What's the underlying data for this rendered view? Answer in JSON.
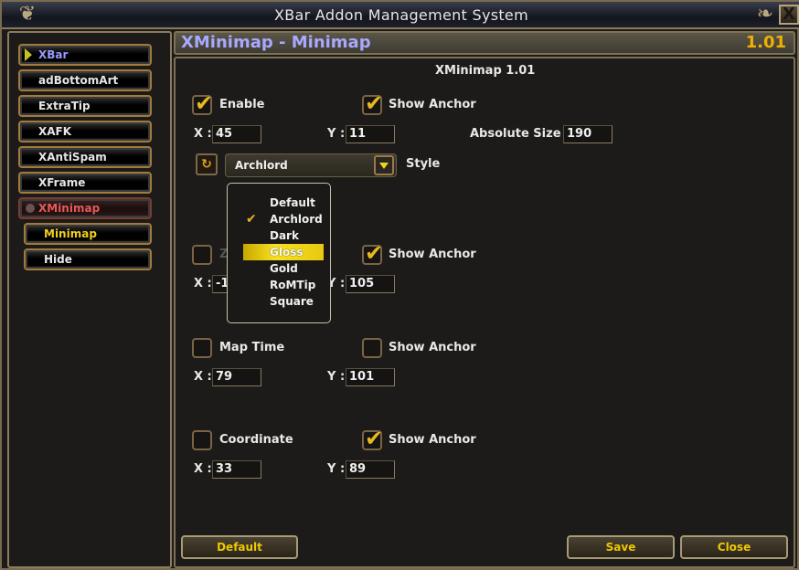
{
  "window": {
    "title": "XBar Addon Management System",
    "close_label": "X"
  },
  "sidebar": {
    "items": [
      {
        "label": "XBar",
        "state": "active"
      },
      {
        "label": "adBottomArt",
        "state": "normal"
      },
      {
        "label": "ExtraTip",
        "state": "normal"
      },
      {
        "label": "XAFK",
        "state": "normal"
      },
      {
        "label": "XAntiSpam",
        "state": "normal"
      },
      {
        "label": "XFrame",
        "state": "normal"
      },
      {
        "label": "XMinimap",
        "state": "expanded"
      }
    ],
    "subitems": [
      {
        "label": "Minimap",
        "state": "selected"
      },
      {
        "label": "Hide",
        "state": "normal"
      }
    ]
  },
  "panel": {
    "title": "XMinimap - Minimap",
    "version": "1.01",
    "heading": "XMinimap 1.01"
  },
  "minimap": {
    "enable": {
      "label": "Enable",
      "checked": true
    },
    "show_anchor": {
      "label": "Show Anchor",
      "checked": true
    },
    "x_label": "X :",
    "x": "45",
    "y_label": "Y :",
    "y": "11",
    "abs_size_label": "Absolute Size :",
    "abs_size": "190",
    "style_label": "Style",
    "style_value": "Archlord",
    "style_icon": "reset-icon"
  },
  "style_menu": {
    "options": [
      "Default",
      "Archlord",
      "Dark",
      "Gloss",
      "Gold",
      "RoMTip",
      "Square"
    ],
    "checked": "Archlord",
    "highlighted": "Gloss"
  },
  "zone_name": {
    "label": "Zone Name",
    "checked": false,
    "show_anchor": {
      "label": "Show Anchor",
      "checked": true
    },
    "x_label": "X :",
    "x": "-15",
    "y_label": "Y :",
    "y": "105"
  },
  "map_time": {
    "label": "Map Time",
    "checked": false,
    "show_anchor": {
      "label": "Show Anchor",
      "checked": false
    },
    "x_label": "X :",
    "x": "79",
    "y_label": "Y :",
    "y": "101"
  },
  "coordinate": {
    "label": "Coordinate",
    "checked": false,
    "show_anchor": {
      "label": "Show Anchor",
      "checked": true
    },
    "x_label": "X :",
    "x": "33",
    "y_label": "Y :",
    "y": "89"
  },
  "buttons": {
    "default": "Default",
    "save": "Save",
    "close": "Close"
  },
  "colors": {
    "title_blue": "#a8a8ff",
    "version_gold": "#f0b000",
    "button_text": "#f0c800",
    "check_gold": "#e8b820",
    "active_red": "#e85a5a",
    "highlight_yellow": "#f8e020"
  }
}
